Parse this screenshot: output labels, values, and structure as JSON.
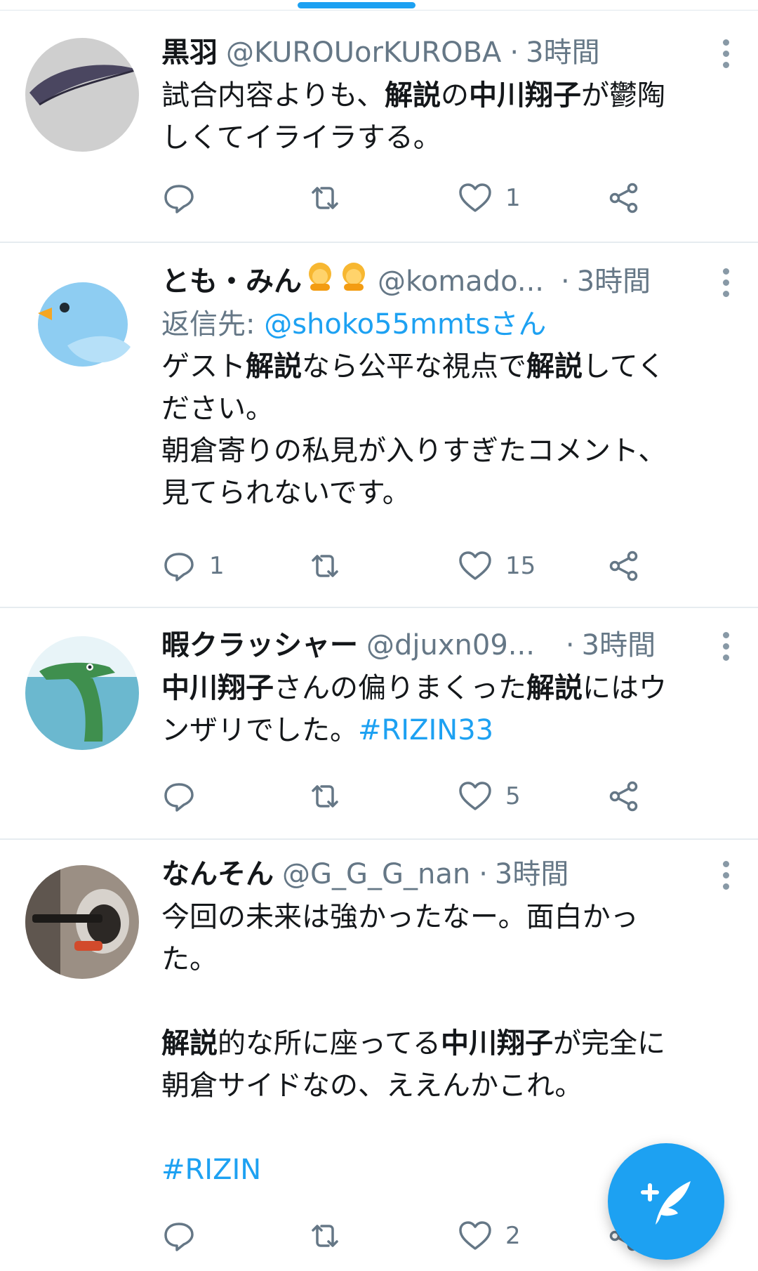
{
  "tweets": [
    {
      "name": "黒羽",
      "handle": "@KUROUorKUROBA",
      "time": "3時間",
      "body_lines": [
        [
          [
            "試合内容よりも、",
            ""
          ],
          [
            "解説",
            "b"
          ],
          [
            "の",
            ""
          ],
          [
            "中川翔子",
            "b"
          ],
          [
            "が鬱陶",
            ""
          ]
        ],
        [
          [
            "しくてイライラする。",
            ""
          ]
        ]
      ],
      "reply_count": "",
      "like_count": "1"
    },
    {
      "name": "とも・みん",
      "handle": "@komado...",
      "time": "3時間",
      "reply_prefix": "返信先: ",
      "reply_mention": "@shoko55mmtsさん",
      "body_lines": [
        [
          [
            "ゲスト",
            ""
          ],
          [
            "解説",
            "b"
          ],
          [
            "なら公平な視点で",
            ""
          ],
          [
            "解説",
            "b"
          ],
          [
            "してく",
            ""
          ]
        ],
        [
          [
            "ださい。",
            ""
          ]
        ],
        [
          [
            "朝倉寄りの私見が入りすぎたコメント、",
            ""
          ]
        ],
        [
          [
            "見てられないです。",
            ""
          ]
        ]
      ],
      "reply_count": "1",
      "like_count": "15"
    },
    {
      "name": "暇クラッシャー",
      "handle": "@djuxn09...",
      "time": "3時間",
      "body_lines": [
        [
          [
            "中川翔子",
            "b"
          ],
          [
            "さんの偏りまくった",
            ""
          ],
          [
            "解説",
            "b"
          ],
          [
            "にはウ",
            ""
          ]
        ],
        [
          [
            "ンザリでした。",
            ""
          ],
          [
            "#RIZIN33",
            "tag"
          ]
        ]
      ],
      "reply_count": "",
      "like_count": "5"
    },
    {
      "name": "なんそん",
      "handle": "@G_G_G_nan",
      "time": "3時間",
      "body_lines": [
        [
          [
            "今回の未来は強かったなー。面白かっ",
            ""
          ]
        ],
        [
          [
            "た。",
            ""
          ]
        ],
        [],
        [
          [
            "解説",
            "b"
          ],
          [
            "的な所に座ってる",
            ""
          ],
          [
            "中川翔子",
            "b"
          ],
          [
            "が完全に",
            ""
          ]
        ],
        [
          [
            "朝倉サイドなの、ええんかこれ。",
            ""
          ]
        ],
        [],
        [
          [
            "#RIZIN",
            "tag"
          ]
        ]
      ],
      "reply_count": "",
      "like_count": "2"
    }
  ],
  "separator": "·",
  "colors": {
    "accent": "#1da1f2",
    "secondary": "#657786",
    "divider": "#e6ecf0"
  },
  "icons": [
    "reply-icon",
    "retweet-icon",
    "like-icon",
    "share-icon",
    "more-icon",
    "compose-icon"
  ]
}
